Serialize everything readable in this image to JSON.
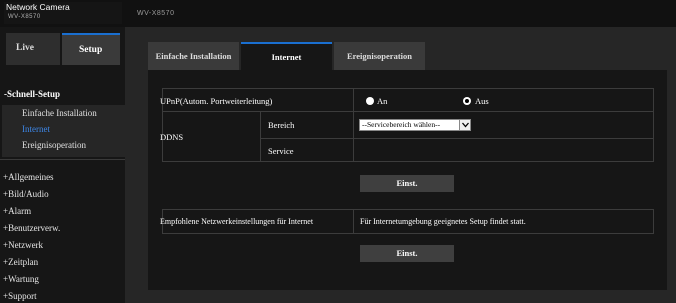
{
  "header": {
    "app_title": "Network Camera",
    "model_small": "WV-X8570",
    "model_right": "WV-X8570"
  },
  "mode_tabs": {
    "live": "Live",
    "setup": "Setup"
  },
  "sidebar": {
    "heading": "-Schnell-Setup",
    "sub_items": [
      "Einfache Installation",
      "Internet",
      "Ereignisoperation"
    ],
    "active_sub_item": "Internet",
    "menu_items": [
      "+Allgemeines",
      "+Bild/Audio",
      "+Alarm",
      "+Benutzerverw.",
      "+Netzwerk",
      "+Zeitplan",
      "+Wartung",
      "+Support"
    ]
  },
  "tabs": [
    "Einfache Installation",
    "Internet",
    "Ereignisoperation"
  ],
  "active_tab": "Internet",
  "upnp": {
    "label": "UPnP(Autom. Portweiterleitung)",
    "on_label": "An",
    "off_label": "Aus",
    "selected": "Aus"
  },
  "ddns": {
    "label": "DDNS",
    "bereich_label": "Bereich",
    "bereich_value": "--Servicebereich wählen--",
    "service_label": "Service",
    "service_value": ""
  },
  "set_button_label": "Einst.",
  "recommend": {
    "label": "Empfohlene Netzwerkeinstellungen für Internet",
    "description": "Für Internetumgebung geeignetes Setup findet statt."
  },
  "set_button_label_2": "Einst.",
  "colors": {
    "accent": "#1a6fd0",
    "active_link": "#3d86e6",
    "background": "#161616",
    "light_frame": "#d8d8d8"
  }
}
